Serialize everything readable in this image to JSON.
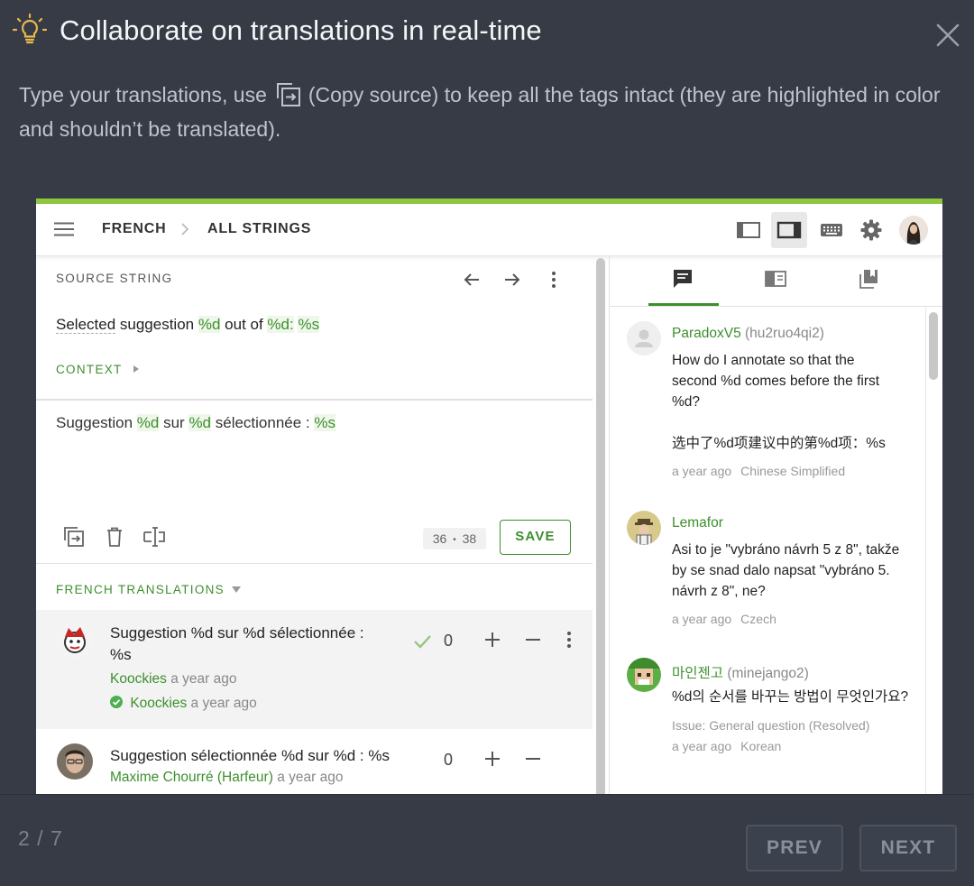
{
  "dialog": {
    "title": "Collaborate on translations in real-time",
    "desc_before": "Type your translations, use",
    "desc_after": "(Copy source) to keep all the tags intact (they are highlighted in color and shouldn’t be translated).",
    "icons": {
      "tip": "lightbulb-icon",
      "close": "close-icon",
      "copy": "copy-source-icon"
    }
  },
  "editor": {
    "breadcrumb": [
      "FRENCH",
      "ALL STRINGS"
    ],
    "toolbar_icons": [
      "sidebar-layout-icon",
      "split-layout-icon",
      "keyboard-icon",
      "gear-icon",
      "user-avatar"
    ],
    "source": {
      "label": "SOURCE STRING",
      "text_parts": [
        "Selected",
        " suggestion ",
        "%d",
        " out of ",
        "%d:",
        " ",
        "%s"
      ],
      "context_label": "CONTEXT",
      "nav_icons": [
        "arrow-left-icon",
        "arrow-right-icon",
        "more-vert-icon"
      ]
    },
    "translation": {
      "text_parts": [
        "Suggestion ",
        "%d",
        " sur ",
        "%d",
        " sélectionnée : ",
        "%s"
      ],
      "tools": [
        "copy-source-icon",
        "delete-icon",
        "text-cursor-icon"
      ],
      "counter_a": "36",
      "counter_sep": "•",
      "counter_b": "38",
      "save_label": "SAVE"
    },
    "suggestions": {
      "label": "FRENCH TRANSLATIONS",
      "items": [
        {
          "text_line1": "Suggestion %d sur %d sélectionnée :",
          "text_line2": "%s",
          "author": "Koockies",
          "time": "a year ago",
          "approver": "Koockies",
          "approve_time": "a year ago",
          "votes": "0",
          "approved": true
        },
        {
          "text_line1": "Suggestion sélectionnée %d sur %d : %s",
          "author": "Maxime Chourré (Harfeur)",
          "time": "a year ago",
          "votes": "0",
          "approved": false
        }
      ]
    },
    "comments": {
      "tabs": [
        "comments-tab-icon",
        "glossary-tab-icon",
        "tm-tab-icon"
      ],
      "items": [
        {
          "name": "ParadoxV5",
          "handle": "(hu2ruo4qi2)",
          "lines": [
            "How do I annotate so that the",
            "second %d comes before the first",
            "%d?",
            "",
            "选中了%d项建议中的第%d项：%s"
          ],
          "time": "a year ago",
          "lang": "Chinese Simplified"
        },
        {
          "name": "Lemafor",
          "handle": "",
          "lines": [
            "Asi to je \"vybráno návrh 5 z 8\", takže",
            "by se snad dalo napsat \"vybráno 5.",
            "návrh z 8\", ne?"
          ],
          "time": "a year ago",
          "lang": "Czech"
        },
        {
          "name": "마인젠고",
          "handle": "(minejango2)",
          "lines": [
            "%d의 순서를 바꾸는 방법이 무엇인가요?"
          ],
          "issue": "Issue: General question (Resolved)",
          "time": "a year ago",
          "lang": "Korean"
        }
      ]
    }
  },
  "footer": {
    "pager": "2 / 7",
    "prev_label": "PREV",
    "next_label": "NEXT"
  },
  "colors": {
    "background": "#363b46",
    "accent": "#3d8f2e",
    "bulb": "#e8b84a",
    "progress": "#8ec63f"
  }
}
